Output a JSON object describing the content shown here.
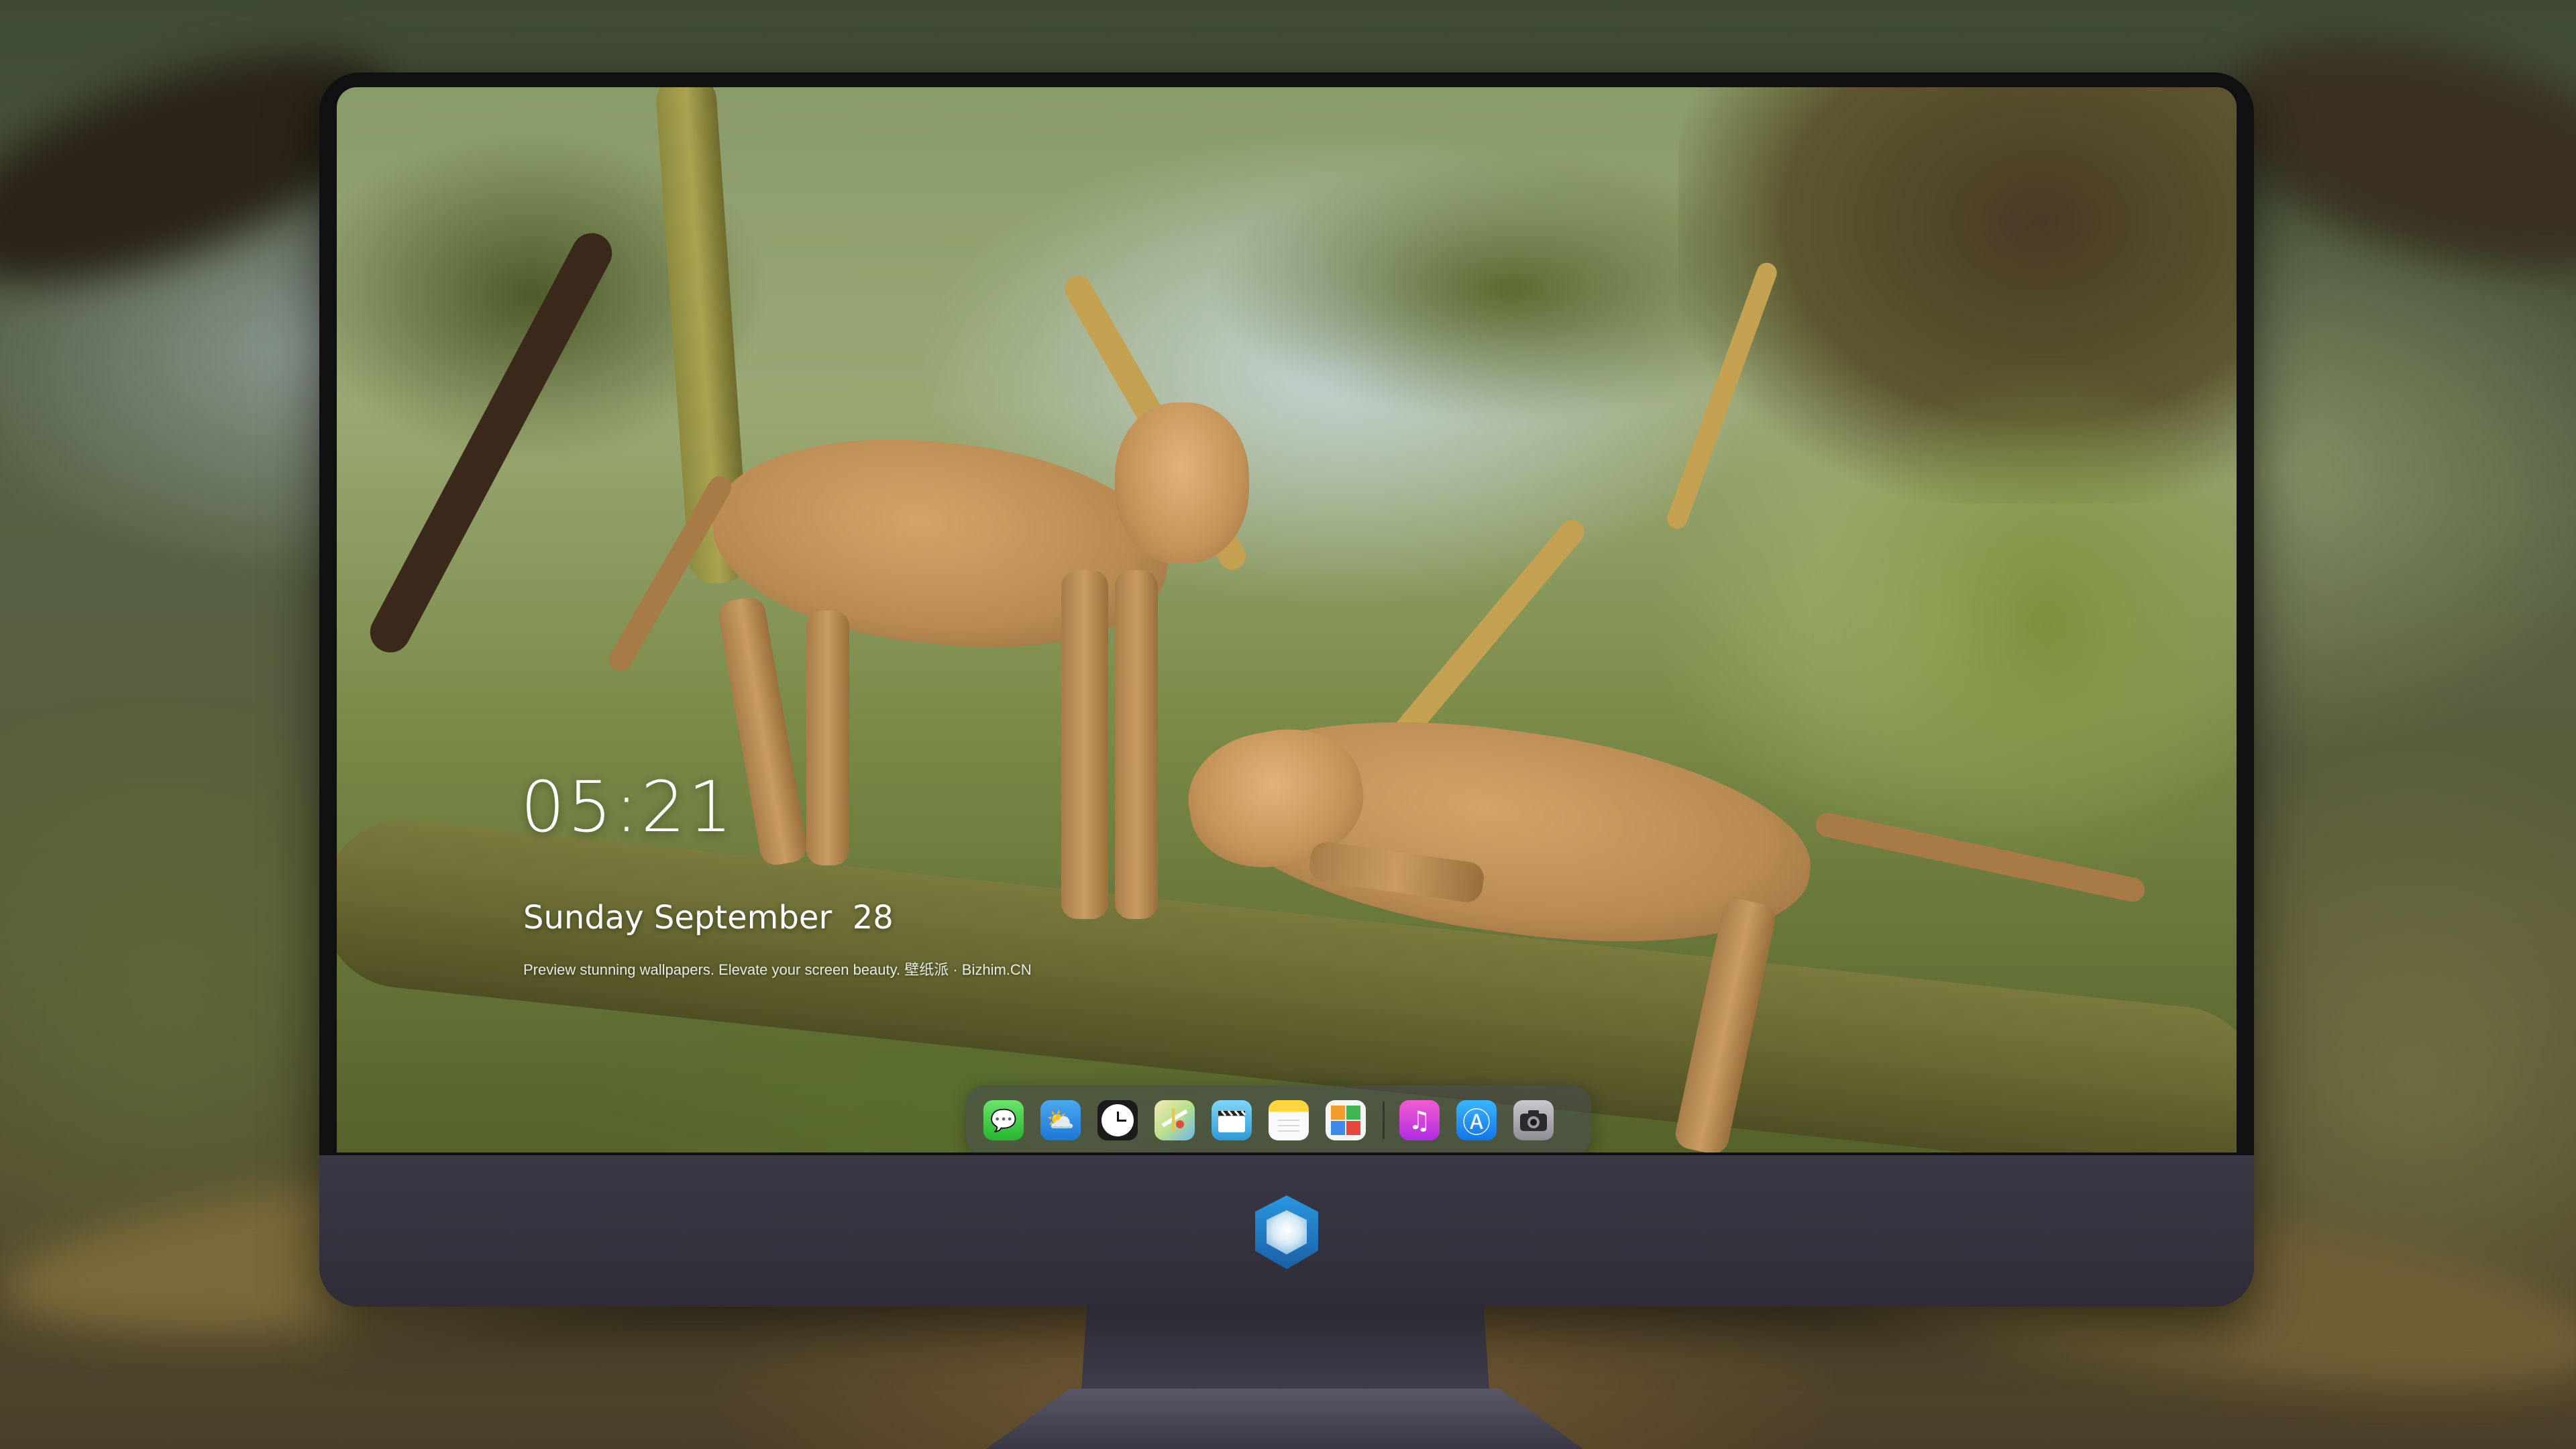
{
  "lock_screen": {
    "time": "05:21",
    "date": "Sunday September  28",
    "tagline": "Preview stunning wallpapers. Elevate your screen beauty. 壁纸派 · Bizhim.CN"
  },
  "dock": {
    "apps": [
      {
        "name": "Messages",
        "icon": "speech-bubble-icon",
        "color": "#25b52f"
      },
      {
        "name": "Weather",
        "icon": "cloud-sun-icon",
        "color": "#1e78d6"
      },
      {
        "name": "Clock",
        "icon": "clock-face-icon",
        "color": "#1b1b1b"
      },
      {
        "name": "Maps",
        "icon": "map-icon",
        "color": "#b9e08a"
      },
      {
        "name": "Clips",
        "icon": "clapperboard-icon",
        "color": "#2e9ad6"
      },
      {
        "name": "Notes",
        "icon": "notepad-icon",
        "color": "#ffd53d"
      },
      {
        "name": "Photos",
        "icon": "photo-grid-icon",
        "color": "#f4f4f4"
      },
      {
        "name": "Music",
        "icon": "music-note-icon",
        "color": "#b12ce3"
      },
      {
        "name": "App Store",
        "icon": "app-store-icon",
        "color": "#1275e8"
      },
      {
        "name": "Camera",
        "icon": "camera-icon",
        "color": "#8d8d94"
      }
    ],
    "glyphs": {
      "messages": "💬",
      "weather": "⛅",
      "music": "♫",
      "appstore": "Ⓐ",
      "camera": "◉"
    }
  },
  "monitor": {
    "bezel_color": "#111114",
    "chin_color": "#3b3845",
    "logo": "dragon-shield-logo"
  }
}
